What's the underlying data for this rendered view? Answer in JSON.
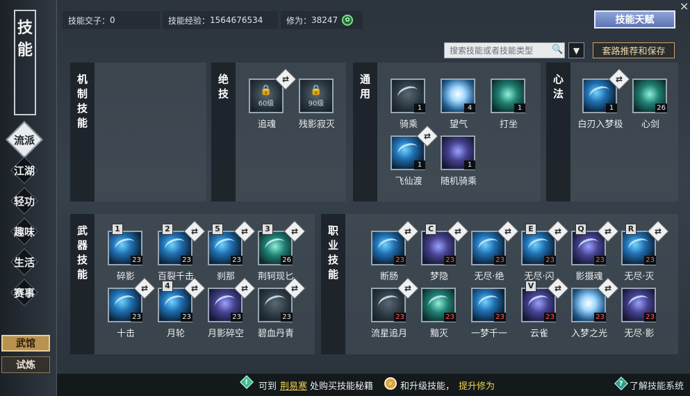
{
  "sidebar": {
    "title_chars": [
      "技",
      "能"
    ],
    "nav": [
      "流派",
      "江湖",
      "轻功",
      "趣味",
      "生活",
      "赛事"
    ],
    "active": "流派",
    "wuguan": "武馆",
    "shilian": "试炼"
  },
  "top": {
    "jiaozi_label": "技能交子：",
    "jiaozi_value": "0",
    "exp_label": "技能经验：",
    "exp_value": "1564676534",
    "xiuwei_label": "修为：",
    "xiuwei_value": "38247",
    "talent_button": "技能天赋",
    "search_placeholder": "搜索技能或者技能类型",
    "recommend_button": "套路推荐和保存"
  },
  "panels": {
    "jizhi": {
      "title": [
        "机",
        "制",
        "技",
        "能"
      ]
    },
    "jueji": {
      "title": [
        "绝",
        "技"
      ],
      "skills": [
        {
          "name": "追魂",
          "lock": "60级"
        },
        {
          "name": "残影寂灭",
          "lock": "90级"
        }
      ]
    },
    "tongyong": {
      "title": [
        "通",
        "用"
      ],
      "skills": [
        {
          "name": "骑乘",
          "level": "1"
        },
        {
          "name": "望气",
          "level": "4"
        },
        {
          "name": "打坐",
          "level": "1"
        },
        {
          "name": "飞仙渡",
          "level": "1"
        },
        {
          "name": "随机骑乘",
          "level": "1"
        }
      ]
    },
    "xinfa": {
      "title": [
        "心",
        "法"
      ],
      "skills": [
        {
          "name": "白刃入梦极",
          "level": "1"
        },
        {
          "name": "心剑",
          "level": "26"
        }
      ]
    },
    "wuqi": {
      "title": [
        "武",
        "器",
        "技",
        "能"
      ],
      "skills": [
        {
          "name": "碎影",
          "level": "23",
          "key": "1"
        },
        {
          "name": "百裂千击",
          "level": "23",
          "key": "2"
        },
        {
          "name": "刹那",
          "level": "23",
          "key": "5"
        },
        {
          "name": "荆轲现匕",
          "level": "26",
          "key": "3"
        },
        {
          "name": "十击",
          "level": "23"
        },
        {
          "name": "月轮",
          "level": "23",
          "key": "4"
        },
        {
          "name": "月影碎空",
          "level": "23"
        },
        {
          "name": "碧血丹青",
          "level": "23"
        }
      ]
    },
    "zhiye": {
      "title": [
        "职",
        "业",
        "技",
        "能"
      ],
      "skills": [
        {
          "name": "断肠",
          "level": "23"
        },
        {
          "name": "梦隐",
          "level": "23",
          "key": "C"
        },
        {
          "name": "无尽·绝",
          "level": "23"
        },
        {
          "name": "无尽·闪",
          "level": "23",
          "key": "E"
        },
        {
          "name": "影摄魂",
          "level": "23",
          "key": "Q"
        },
        {
          "name": "无尽·灭",
          "level": "23",
          "key": "R"
        },
        {
          "name": "流星追月",
          "level": "23"
        },
        {
          "name": "黯灭",
          "level": "23"
        },
        {
          "name": "一梦千一",
          "level": "23"
        },
        {
          "name": "云雀",
          "level": "23",
          "key": "V"
        },
        {
          "name": "入梦之光",
          "level": "23"
        },
        {
          "name": "无尽·影",
          "level": "23"
        }
      ]
    }
  },
  "bottom": {
    "t1": "可到",
    "link": "荆易寒",
    "t2": "处购买技能秘籍",
    "t3": "和升级技能，",
    "highlight": "提升修为",
    "help": "了解技能系统"
  },
  "colors": {
    "accent_gold": "#e8c35a",
    "link_yellow": "#f0d24a",
    "level_red": "#ff5a5a"
  }
}
